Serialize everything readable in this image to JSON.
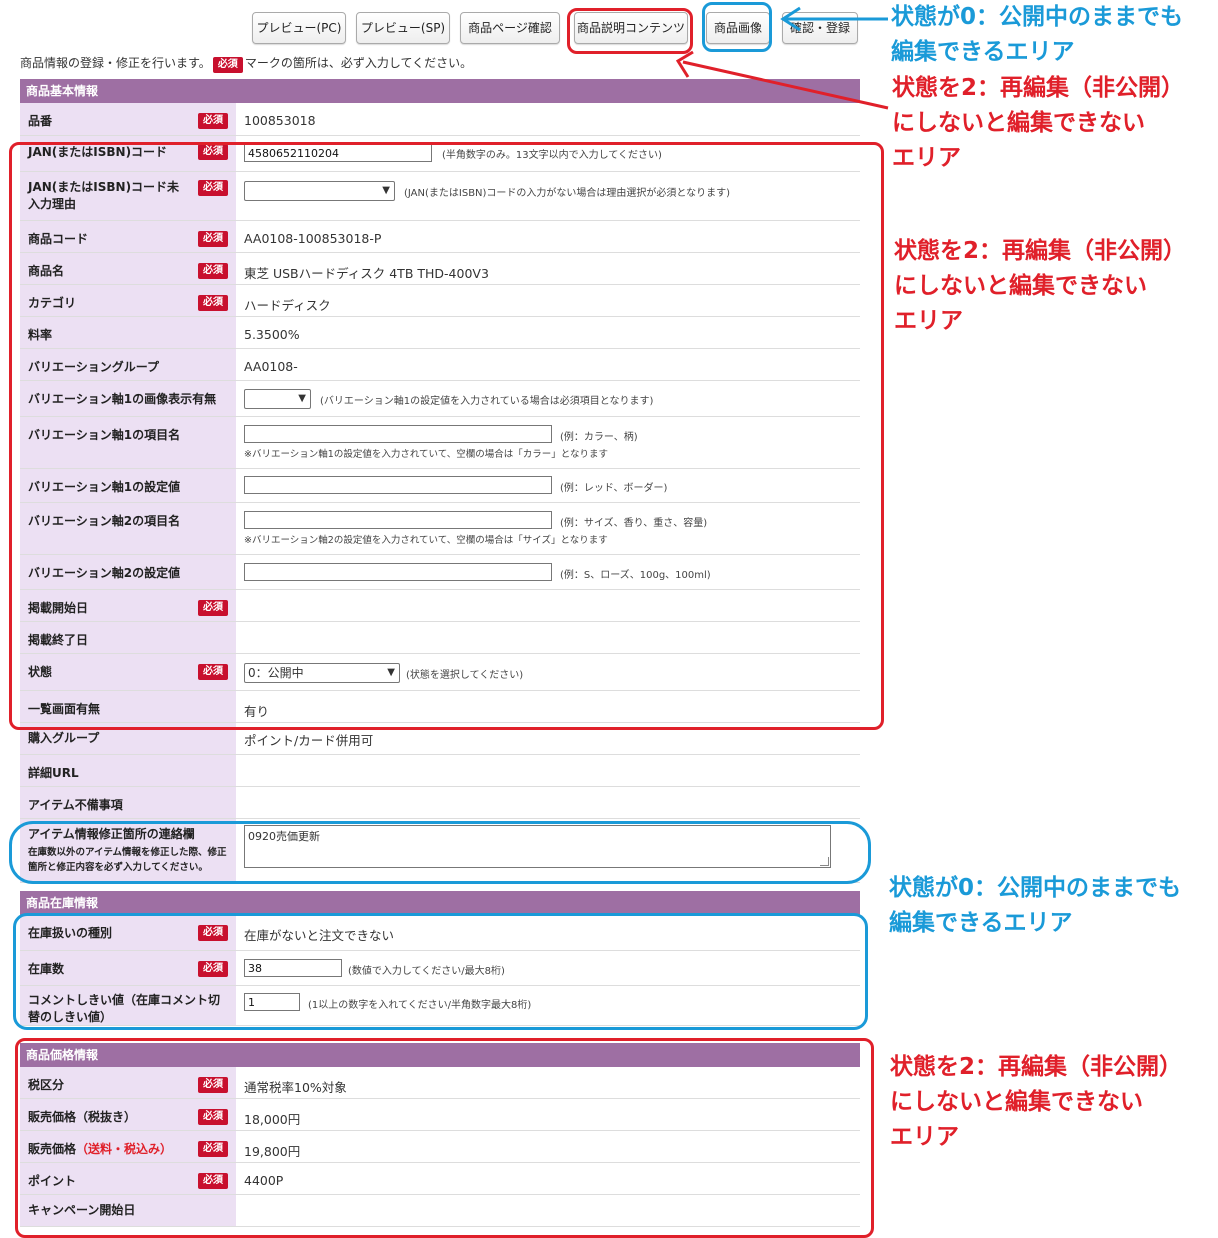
{
  "toolbar": {
    "preview_pc": "プレビュー(PC)",
    "preview_sp": "プレビュー(SP)",
    "page_check": "商品ページ確認",
    "description_contents": "商品説明コンテンツ",
    "product_images": "商品画像",
    "register": "確認・登録"
  },
  "intro": {
    "before": "商品情報の登録・修正を行います。",
    "badge": "必須",
    "after": "マークの箇所は、必ず入力してください。"
  },
  "required_label": "必須",
  "basic": {
    "title": "商品基本情報",
    "item_no": {
      "label": "品番",
      "value": "100853018"
    },
    "jan": {
      "label": "JAN(またはISBN)コード",
      "value": "4580652110204",
      "hint": "(半角数字のみ。13文字以内で入力してください)"
    },
    "jan_reason": {
      "label": "JAN(またはISBN)コード未入力理由",
      "value": "",
      "hint": "(JAN(またはISBN)コードの入力がない場合は理由選択が必須となります)"
    },
    "product_code": {
      "label": "商品コード",
      "value": "AA0108-100853018-P"
    },
    "product_name": {
      "label": "商品名",
      "value": "東芝 USBハードディスク 4TB THD-400V3"
    },
    "category": {
      "label": "カテゴリ",
      "value": "ハードディスク"
    },
    "rate": {
      "label": "料率",
      "value": "5.3500%"
    },
    "variation_group": {
      "label": "バリエーショングループ",
      "value": "AA0108-"
    },
    "var1_image": {
      "label": "バリエーション軸1の画像表示有無",
      "value": "",
      "hint": "(バリエーション軸1の設定値を入力されている場合は必須項目となります)"
    },
    "var1_name": {
      "label": "バリエーション軸1の項目名",
      "value": "",
      "hint": "(例：カラー、柄)",
      "note": "※バリエーション軸1の設定値を入力されていて、空欄の場合は「カラー」となります"
    },
    "var1_value": {
      "label": "バリエーション軸1の設定値",
      "value": "",
      "hint": "(例：レッド、ボーダー)"
    },
    "var2_name": {
      "label": "バリエーション軸2の項目名",
      "value": "",
      "hint": "(例：サイズ、香り、重さ、容量)",
      "note": "※バリエーション軸2の設定値を入力されていて、空欄の場合は「サイズ」となります"
    },
    "var2_value": {
      "label": "バリエーション軸2の設定値",
      "value": "",
      "hint": "(例：S、ローズ、100g、100ml)"
    },
    "start_date": {
      "label": "掲載開始日",
      "value": ""
    },
    "end_date": {
      "label": "掲載終了日",
      "value": ""
    },
    "status": {
      "label": "状態",
      "value": "0：公開中",
      "hint": "(状態を選択してください)"
    },
    "list_display": {
      "label": "一覧画面有無",
      "value": "有り"
    },
    "purchase_group": {
      "label": "購入グループ",
      "value": "ポイント/カード併用可"
    },
    "detail_url": {
      "label": "詳細URL",
      "value": ""
    },
    "item_defect": {
      "label": "アイテム不備事項",
      "value": ""
    },
    "contact": {
      "label": "アイテム情報修正箇所の連絡欄",
      "sub": "在庫数以外のアイテム情報を修正した際、修正箇所と修正内容を必ず入力してください。",
      "value": "0920売価更新"
    }
  },
  "stock": {
    "title": "商品在庫情報",
    "type": {
      "label": "在庫扱いの種別",
      "value": "在庫がないと注文できない"
    },
    "count": {
      "label": "在庫数",
      "value": "38",
      "hint": "(数値で入力してください/最大8桁)"
    },
    "threshold": {
      "label": "コメントしきい値（在庫コメント切替のしきい値）",
      "value": "1",
      "hint": "(1以上の数字を入れてください/半角数字最大8桁)"
    }
  },
  "price": {
    "title": "商品価格情報",
    "tax_class": {
      "label": "税区分",
      "value": "通常税率10%対象"
    },
    "price_ex": {
      "label": "販売価格（税抜き）",
      "value": "18,000円"
    },
    "price_inc": {
      "label": "販売価格",
      "label_red": "（送料・税込み）",
      "value": "19,800円"
    },
    "point": {
      "label": "ポイント",
      "value": "4400P"
    },
    "campaign_start": {
      "label": "キャンペーン開始日",
      "value": ""
    }
  },
  "annotations": {
    "editable_while_public": [
      "状態が0：公開中のままでも",
      "編集できるエリア"
    ],
    "requires_reedit": [
      "状態を2：再編集（非公開）",
      "にしないと編集できない",
      "エリア"
    ]
  },
  "colors": {
    "red": "#e0202a",
    "blue": "#1a9ad8",
    "header": "#9e6fa3",
    "label_bg": "#ece0f3",
    "required": "#c8102e"
  },
  "icons": {
    "dropdown": "chevron-down-icon",
    "arrow": "arrow-left-icon"
  }
}
